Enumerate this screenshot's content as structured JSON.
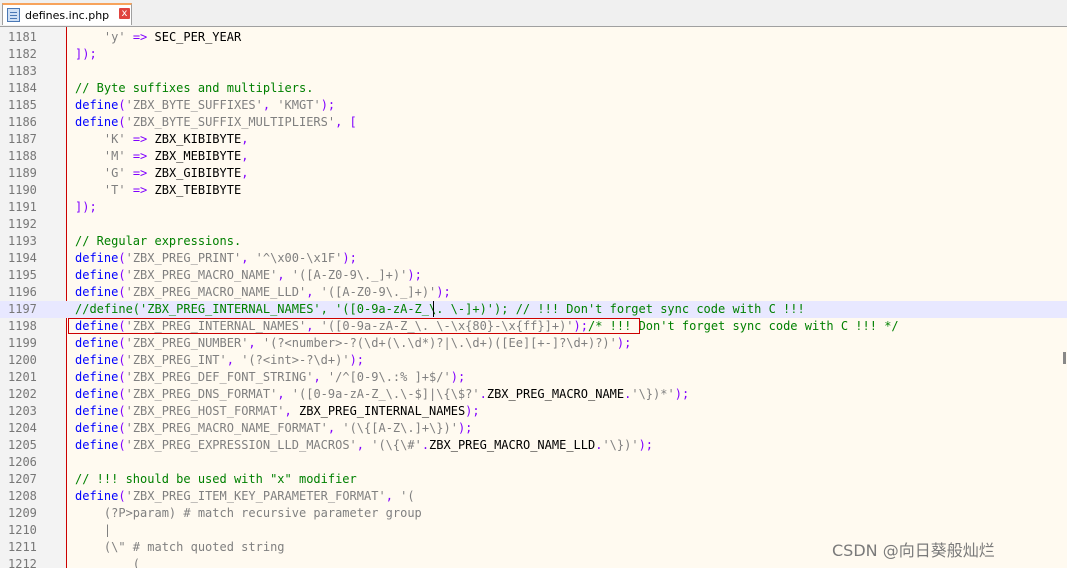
{
  "tab": {
    "filename": "defines.inc.php",
    "close_glyph": "x"
  },
  "lines": [
    {
      "num": "1181",
      "tokens": [
        {
          "t": "    ",
          "c": ""
        },
        {
          "t": "'y'",
          "c": "str"
        },
        {
          "t": " => ",
          "c": "op"
        },
        {
          "t": "SEC_PER_YEAR",
          "c": "con"
        }
      ]
    },
    {
      "num": "1182",
      "tokens": [
        {
          "t": "]);",
          "c": "op"
        }
      ]
    },
    {
      "num": "1183",
      "tokens": []
    },
    {
      "num": "1184",
      "tokens": [
        {
          "t": "// Byte suffixes and multipliers.",
          "c": "cmt"
        }
      ]
    },
    {
      "num": "1185",
      "tokens": [
        {
          "t": "define",
          "c": "kw"
        },
        {
          "t": "(",
          "c": "op"
        },
        {
          "t": "'ZBX_BYTE_SUFFIXES'",
          "c": "str"
        },
        {
          "t": ", ",
          "c": "op"
        },
        {
          "t": "'KMGT'",
          "c": "str"
        },
        {
          "t": ");",
          "c": "op"
        }
      ]
    },
    {
      "num": "1186",
      "tokens": [
        {
          "t": "define",
          "c": "kw"
        },
        {
          "t": "(",
          "c": "op"
        },
        {
          "t": "'ZBX_BYTE_SUFFIX_MULTIPLIERS'",
          "c": "str"
        },
        {
          "t": ", [",
          "c": "op"
        }
      ]
    },
    {
      "num": "1187",
      "tokens": [
        {
          "t": "    ",
          "c": ""
        },
        {
          "t": "'K'",
          "c": "str"
        },
        {
          "t": " => ",
          "c": "op"
        },
        {
          "t": "ZBX_KIBIBYTE",
          "c": "con"
        },
        {
          "t": ",",
          "c": "op"
        }
      ]
    },
    {
      "num": "1188",
      "tokens": [
        {
          "t": "    ",
          "c": ""
        },
        {
          "t": "'M'",
          "c": "str"
        },
        {
          "t": " => ",
          "c": "op"
        },
        {
          "t": "ZBX_MEBIBYTE",
          "c": "con"
        },
        {
          "t": ",",
          "c": "op"
        }
      ]
    },
    {
      "num": "1189",
      "tokens": [
        {
          "t": "    ",
          "c": ""
        },
        {
          "t": "'G'",
          "c": "str"
        },
        {
          "t": " => ",
          "c": "op"
        },
        {
          "t": "ZBX_GIBIBYTE",
          "c": "con"
        },
        {
          "t": ",",
          "c": "op"
        }
      ]
    },
    {
      "num": "1190",
      "tokens": [
        {
          "t": "    ",
          "c": ""
        },
        {
          "t": "'T'",
          "c": "str"
        },
        {
          "t": " => ",
          "c": "op"
        },
        {
          "t": "ZBX_TEBIBYTE",
          "c": "con"
        }
      ]
    },
    {
      "num": "1191",
      "tokens": [
        {
          "t": "]);",
          "c": "op"
        }
      ]
    },
    {
      "num": "1192",
      "tokens": []
    },
    {
      "num": "1193",
      "tokens": [
        {
          "t": "// Regular expressions.",
          "c": "cmt"
        }
      ]
    },
    {
      "num": "1194",
      "tokens": [
        {
          "t": "define",
          "c": "kw"
        },
        {
          "t": "(",
          "c": "op"
        },
        {
          "t": "'ZBX_PREG_PRINT'",
          "c": "str"
        },
        {
          "t": ", ",
          "c": "op"
        },
        {
          "t": "'^\\x00-\\x1F'",
          "c": "str"
        },
        {
          "t": ");",
          "c": "op"
        }
      ]
    },
    {
      "num": "1195",
      "tokens": [
        {
          "t": "define",
          "c": "kw"
        },
        {
          "t": "(",
          "c": "op"
        },
        {
          "t": "'ZBX_PREG_MACRO_NAME'",
          "c": "str"
        },
        {
          "t": ", ",
          "c": "op"
        },
        {
          "t": "'([A-Z0-9\\._]+)'",
          "c": "str"
        },
        {
          "t": ");",
          "c": "op"
        }
      ]
    },
    {
      "num": "1196",
      "tokens": [
        {
          "t": "define",
          "c": "kw"
        },
        {
          "t": "(",
          "c": "op"
        },
        {
          "t": "'ZBX_PREG_MACRO_NAME_LLD'",
          "c": "str"
        },
        {
          "t": ", ",
          "c": "op"
        },
        {
          "t": "'([A-Z0-9\\._]+)'",
          "c": "str"
        },
        {
          "t": ");",
          "c": "op"
        }
      ]
    },
    {
      "num": "1197",
      "current": true,
      "tokens": [
        {
          "t": "//define('ZBX_PREG_INTERNAL_NAMES', '([0-9a-zA-Z_\\. \\-]+)'); // !!! Don't forget sync code with C !!!",
          "c": "cmt"
        }
      ]
    },
    {
      "num": "1198",
      "tokens": [
        {
          "t": "define",
          "c": "kw"
        },
        {
          "t": "(",
          "c": "op"
        },
        {
          "t": "'ZBX_PREG_INTERNAL_NAMES'",
          "c": "str"
        },
        {
          "t": ", ",
          "c": "op"
        },
        {
          "t": "'([0-9a-zA-Z_\\. \\-\\x{80}-\\x{ff}]+)'",
          "c": "str"
        },
        {
          "t": ");",
          "c": "op"
        },
        {
          "t": "/* !!! Don't forget sync code with C !!! */",
          "c": "cmt"
        }
      ]
    },
    {
      "num": "1199",
      "tokens": [
        {
          "t": "define",
          "c": "kw"
        },
        {
          "t": "(",
          "c": "op"
        },
        {
          "t": "'ZBX_PREG_NUMBER'",
          "c": "str"
        },
        {
          "t": ", ",
          "c": "op"
        },
        {
          "t": "'(?<number>-?(\\d+(\\.\\d*)?|\\.\\d+)([Ee][+-]?\\d+)?)'",
          "c": "str"
        },
        {
          "t": ");",
          "c": "op"
        }
      ]
    },
    {
      "num": "1200",
      "tokens": [
        {
          "t": "define",
          "c": "kw"
        },
        {
          "t": "(",
          "c": "op"
        },
        {
          "t": "'ZBX_PREG_INT'",
          "c": "str"
        },
        {
          "t": ", ",
          "c": "op"
        },
        {
          "t": "'(?<int>-?\\d+)'",
          "c": "str"
        },
        {
          "t": ");",
          "c": "op"
        }
      ]
    },
    {
      "num": "1201",
      "tokens": [
        {
          "t": "define",
          "c": "kw"
        },
        {
          "t": "(",
          "c": "op"
        },
        {
          "t": "'ZBX_PREG_DEF_FONT_STRING'",
          "c": "str"
        },
        {
          "t": ", ",
          "c": "op"
        },
        {
          "t": "'/^[0-9\\.:% ]+$/'",
          "c": "str"
        },
        {
          "t": ");",
          "c": "op"
        }
      ]
    },
    {
      "num": "1202",
      "tokens": [
        {
          "t": "define",
          "c": "kw"
        },
        {
          "t": "(",
          "c": "op"
        },
        {
          "t": "'ZBX_PREG_DNS_FORMAT'",
          "c": "str"
        },
        {
          "t": ", ",
          "c": "op"
        },
        {
          "t": "'([0-9a-zA-Z_\\.\\-$]|\\{\\$?'",
          "c": "str"
        },
        {
          "t": ".",
          "c": "op"
        },
        {
          "t": "ZBX_PREG_MACRO_NAME",
          "c": "con"
        },
        {
          "t": ".",
          "c": "op"
        },
        {
          "t": "'\\})*'",
          "c": "str"
        },
        {
          "t": ");",
          "c": "op"
        }
      ]
    },
    {
      "num": "1203",
      "tokens": [
        {
          "t": "define",
          "c": "kw"
        },
        {
          "t": "(",
          "c": "op"
        },
        {
          "t": "'ZBX_PREG_HOST_FORMAT'",
          "c": "str"
        },
        {
          "t": ", ",
          "c": "op"
        },
        {
          "t": "ZBX_PREG_INTERNAL_NAMES",
          "c": "con"
        },
        {
          "t": ");",
          "c": "op"
        }
      ]
    },
    {
      "num": "1204",
      "tokens": [
        {
          "t": "define",
          "c": "kw"
        },
        {
          "t": "(",
          "c": "op"
        },
        {
          "t": "'ZBX_PREG_MACRO_NAME_FORMAT'",
          "c": "str"
        },
        {
          "t": ", ",
          "c": "op"
        },
        {
          "t": "'(\\{[A-Z\\.]+\\})'",
          "c": "str"
        },
        {
          "t": ");",
          "c": "op"
        }
      ]
    },
    {
      "num": "1205",
      "tokens": [
        {
          "t": "define",
          "c": "kw"
        },
        {
          "t": "(",
          "c": "op"
        },
        {
          "t": "'ZBX_PREG_EXPRESSION_LLD_MACROS'",
          "c": "str"
        },
        {
          "t": ", ",
          "c": "op"
        },
        {
          "t": "'(\\{\\#'",
          "c": "str"
        },
        {
          "t": ".",
          "c": "op"
        },
        {
          "t": "ZBX_PREG_MACRO_NAME_LLD",
          "c": "con"
        },
        {
          "t": ".",
          "c": "op"
        },
        {
          "t": "'\\})'",
          "c": "str"
        },
        {
          "t": ");",
          "c": "op"
        }
      ]
    },
    {
      "num": "1206",
      "tokens": []
    },
    {
      "num": "1207",
      "tokens": [
        {
          "t": "// !!! should be used with \"x\" modifier",
          "c": "cmt"
        }
      ]
    },
    {
      "num": "1208",
      "tokens": [
        {
          "t": "define",
          "c": "kw"
        },
        {
          "t": "(",
          "c": "op"
        },
        {
          "t": "'ZBX_PREG_ITEM_KEY_PARAMETER_FORMAT'",
          "c": "str"
        },
        {
          "t": ", ",
          "c": "op"
        },
        {
          "t": "'(",
          "c": "str"
        }
      ]
    },
    {
      "num": "1209",
      "tokens": [
        {
          "t": "    (?P>param) # match recursive parameter group",
          "c": "str"
        }
      ]
    },
    {
      "num": "1210",
      "tokens": [
        {
          "t": "    |",
          "c": "str"
        }
      ]
    },
    {
      "num": "1211",
      "tokens": [
        {
          "t": "    (\\\" # match quoted string",
          "c": "str"
        }
      ]
    },
    {
      "num": "1212",
      "tokens": [
        {
          "t": "        (",
          "c": "str"
        }
      ]
    }
  ],
  "watermark": "CSDN @向日葵般灿烂",
  "colors": {
    "keyword": "#0000ff",
    "string": "#808080",
    "operator": "#8000ff",
    "comment": "#008000",
    "background": "#fffaf0",
    "current_line": "#e8e8ff"
  }
}
